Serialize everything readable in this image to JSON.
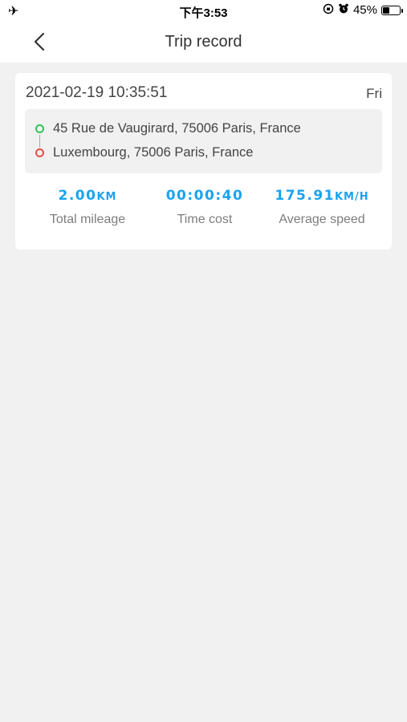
{
  "status_bar": {
    "time": "下午3:53",
    "battery_percent": "45%",
    "battery_level": 0.45,
    "left_icon": "airplane-icon",
    "right_icons": [
      "rotation-lock-icon",
      "alarm-icon"
    ]
  },
  "nav": {
    "title": "Trip record",
    "back_icon": "chevron-left-icon"
  },
  "trip": {
    "datetime": "2021-02-19 10:35:51",
    "weekday": "Fri",
    "start_address": "45 Rue de Vaugirard, 75006 Paris, France",
    "end_address": "Luxembourg, 75006 Paris, France",
    "stats": {
      "mileage_value": "2.00",
      "mileage_unit": "KM",
      "mileage_label": "Total mileage",
      "time_value": "00:00:40",
      "time_label": "Time cost",
      "speed_value": "175.91",
      "speed_unit": "KM/H",
      "speed_label": "Average speed"
    }
  },
  "colors": {
    "accent": "#1aa3f0",
    "start_dot": "#33c35a",
    "end_dot": "#e0504a",
    "background": "#f1f1f1"
  }
}
